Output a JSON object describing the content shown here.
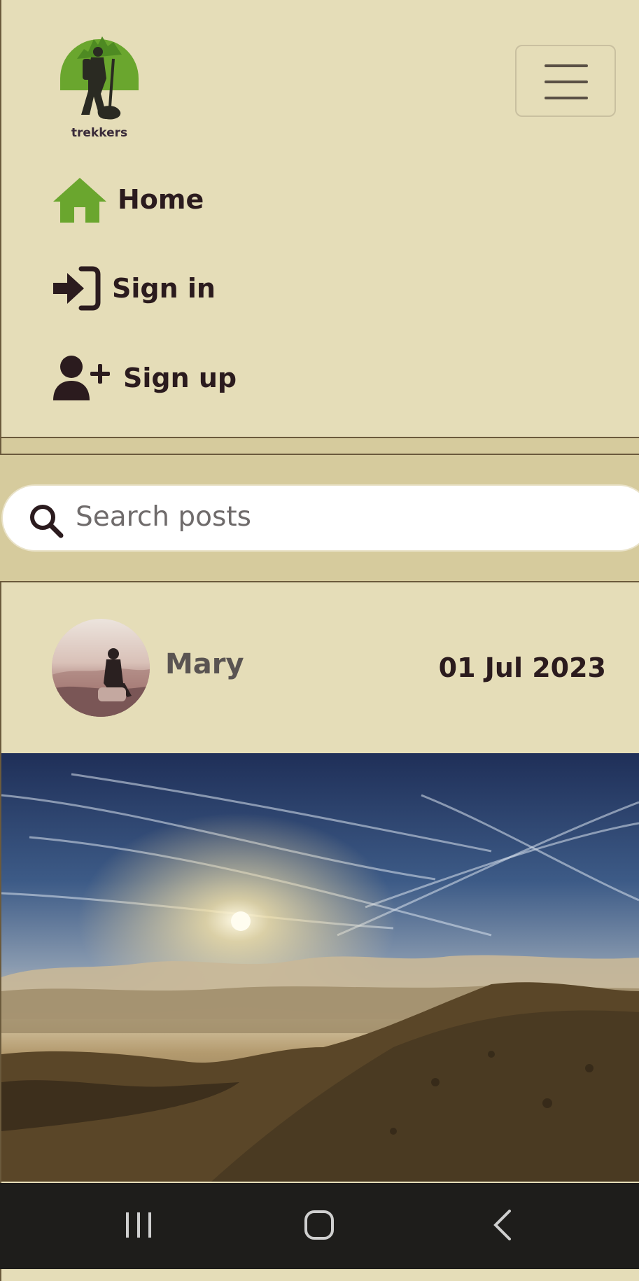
{
  "brand": {
    "logo_text": "trekkers"
  },
  "nav": {
    "items": [
      {
        "label": "Home",
        "icon": "home-icon",
        "color": "#6aa62e"
      },
      {
        "label": "Sign in",
        "icon": "sign-in-icon"
      },
      {
        "label": "Sign up",
        "icon": "user-plus-icon"
      }
    ]
  },
  "search": {
    "placeholder": "Search posts",
    "icon": "search-icon"
  },
  "post": {
    "author": "Mary",
    "date": "01 Jul 2023"
  },
  "colors": {
    "navbar_bg": "#e5ddb8",
    "page_bg": "#d6cb9d",
    "accent_green": "#6aa62e",
    "text_dark": "#2b1b1e"
  },
  "system_nav": {
    "buttons": [
      "recent-apps-icon",
      "home-circle-icon",
      "back-icon"
    ]
  }
}
